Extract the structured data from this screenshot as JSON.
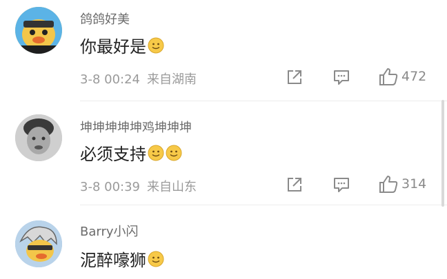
{
  "comments": [
    {
      "username": "鸽鸽好美",
      "content": "你最好是",
      "emoji": [
        "smile-emoji"
      ],
      "date": "3-8 00:24",
      "location": "来自湖南",
      "likes": "472"
    },
    {
      "username": "坤坤坤坤坤鸡坤坤坤",
      "content": "必须支持",
      "emoji": [
        "smile-emoji",
        "smile-emoji"
      ],
      "date": "3-8 00:39",
      "location": "来自山东",
      "likes": "314"
    },
    {
      "username": "Barry小闪",
      "content": "泥醉嚎狮",
      "emoji": [
        "smile-emoji"
      ]
    }
  ],
  "icons": {
    "share": "share-icon",
    "reply": "comment-icon",
    "like": "thumbs-up-icon"
  },
  "colors": {
    "username": "#6b6b6b",
    "content": "#222222",
    "meta": "#9a9a9a",
    "emoji": "#f7c948"
  }
}
